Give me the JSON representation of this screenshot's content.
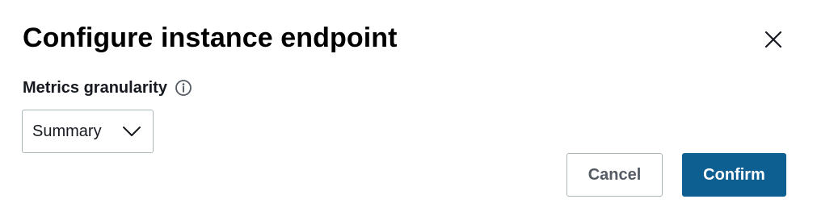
{
  "dialog": {
    "title": "Configure instance endpoint",
    "close_icon": "close-icon"
  },
  "field": {
    "label": "Metrics granularity",
    "info_icon": "info-icon",
    "select": {
      "value": "Summary",
      "caret_icon": "chevron-down-icon"
    }
  },
  "footer": {
    "cancel_label": "Cancel",
    "confirm_label": "Confirm"
  },
  "colors": {
    "primary": "#0d5f91",
    "border": "#aab7b8",
    "cancel_text": "#545b64"
  }
}
